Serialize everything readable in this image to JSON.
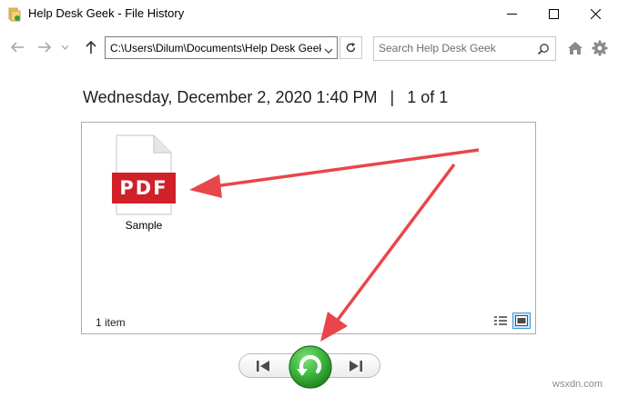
{
  "window": {
    "title": "Help Desk Geek - File History",
    "icons": {
      "app": "folder-history-icon",
      "minimize": "minimize-icon",
      "maximize": "maximize-icon",
      "close": "close-icon"
    }
  },
  "navbar": {
    "address": "C:\\Users\\Dilum\\Documents\\Help Desk Geek",
    "search_placeholder": "Search Help Desk Geek",
    "icons": [
      "back-arrow-icon",
      "forward-arrow-icon",
      "chevron-down-icon",
      "up-arrow-icon",
      "refresh-icon",
      "search-icon",
      "home-icon",
      "gear-icon"
    ]
  },
  "header": {
    "date": "Wednesday, December 2, 2020 1:40 PM",
    "separator": "|",
    "page": "1 of 1"
  },
  "content": {
    "files": [
      {
        "name": "Sample",
        "badge": "PDF",
        "icon": "pdf-file-icon"
      }
    ],
    "status": "1 item"
  },
  "controls": {
    "icons": [
      "previous-version-icon",
      "restore-icon",
      "next-version-icon"
    ]
  },
  "colors": {
    "pdf_red": "#d0202a",
    "restore_green": "#3bb53b",
    "arrow_red": "#e8464b",
    "selected_view_blue": "#3c9bd8"
  },
  "watermark": "wsxdn.com"
}
